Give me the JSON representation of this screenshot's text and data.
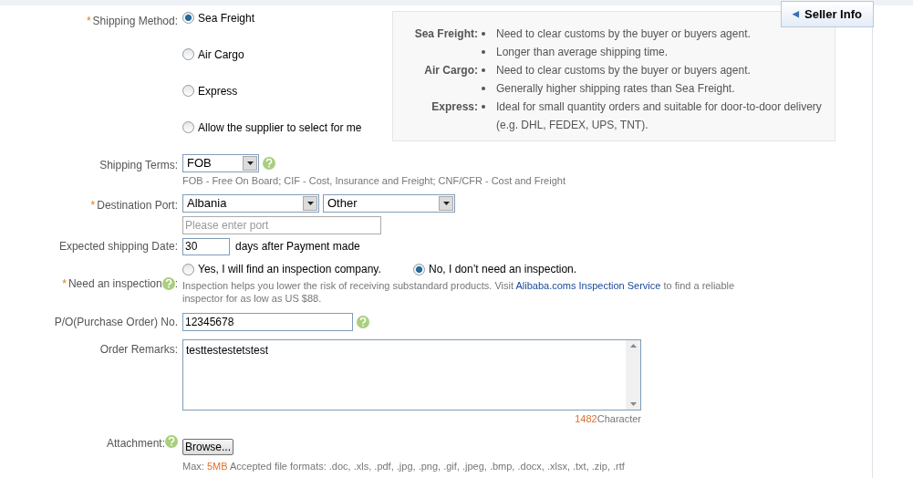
{
  "seller_info_button": {
    "arrow": "◀",
    "label": "Seller Info"
  },
  "shipping_method": {
    "mark": "*",
    "label": "Shipping Method:",
    "options": [
      {
        "label": "Sea Freight",
        "selected": true
      },
      {
        "label": "Air Cargo",
        "selected": false
      },
      {
        "label": "Express",
        "selected": false
      },
      {
        "label": "Allow the supplier to select for me",
        "selected": false
      }
    ]
  },
  "info_panel": [
    {
      "term": "Sea Freight:",
      "points": [
        "Need to clear customs by the buyer or buyers agent.",
        "Longer than average shipping time."
      ]
    },
    {
      "term": "Air Cargo:",
      "points": [
        "Need to clear customs by the buyer or buyers agent.",
        "Generally higher shipping rates than Sea Freight."
      ]
    },
    {
      "term": "Express:",
      "points": [
        "Ideal for small quantity orders and suitable for door-to-door delivery (e.g. DHL, FEDEX, UPS, TNT)."
      ]
    }
  ],
  "shipping_terms": {
    "label": "Shipping Terms:",
    "value": "FOB",
    "hint": "FOB - Free On Board; CIF - Cost, Insurance and Freight; CNF/CFR - Cost and Freight"
  },
  "destination_port": {
    "mark": "*",
    "label": "Destination Port:",
    "country": "Albania",
    "port": "Other",
    "placeholder": "Please enter port"
  },
  "shipping_date": {
    "label": "Expected shipping Date:",
    "value": "30",
    "suffix": "days after Payment made"
  },
  "inspection": {
    "mark": "*",
    "label": "Need an inspection",
    "colon": ":",
    "options": [
      {
        "label": "Yes, I will find an inspection company.",
        "selected": false
      },
      {
        "label": "No, I don’t need an inspection.",
        "selected": true
      }
    ],
    "help_before": "Inspection helps you lower the risk of receiving substandard products. Visit",
    "help_link": "Alibaba.coms Inspection Service",
    "help_after": "to find a reliable inspector for as low as US $88."
  },
  "po_number": {
    "label": "P/O(Purchase Order) No.",
    "value": "12345678"
  },
  "order_remarks": {
    "label": "Order Remarks:",
    "value": "testtestestetstest",
    "count": "1482",
    "count_unit": "Character"
  },
  "attachment": {
    "label": "Attachment:",
    "button": "Browse...",
    "max_prefix": "Max:",
    "max_size": "5MB",
    "formats": "Accepted file formats: .doc, .xls, .pdf, .jpg, .png, .gif, .jpeg, .bmp, .docx, .xlsx, .txt, .zip, .rtf"
  }
}
